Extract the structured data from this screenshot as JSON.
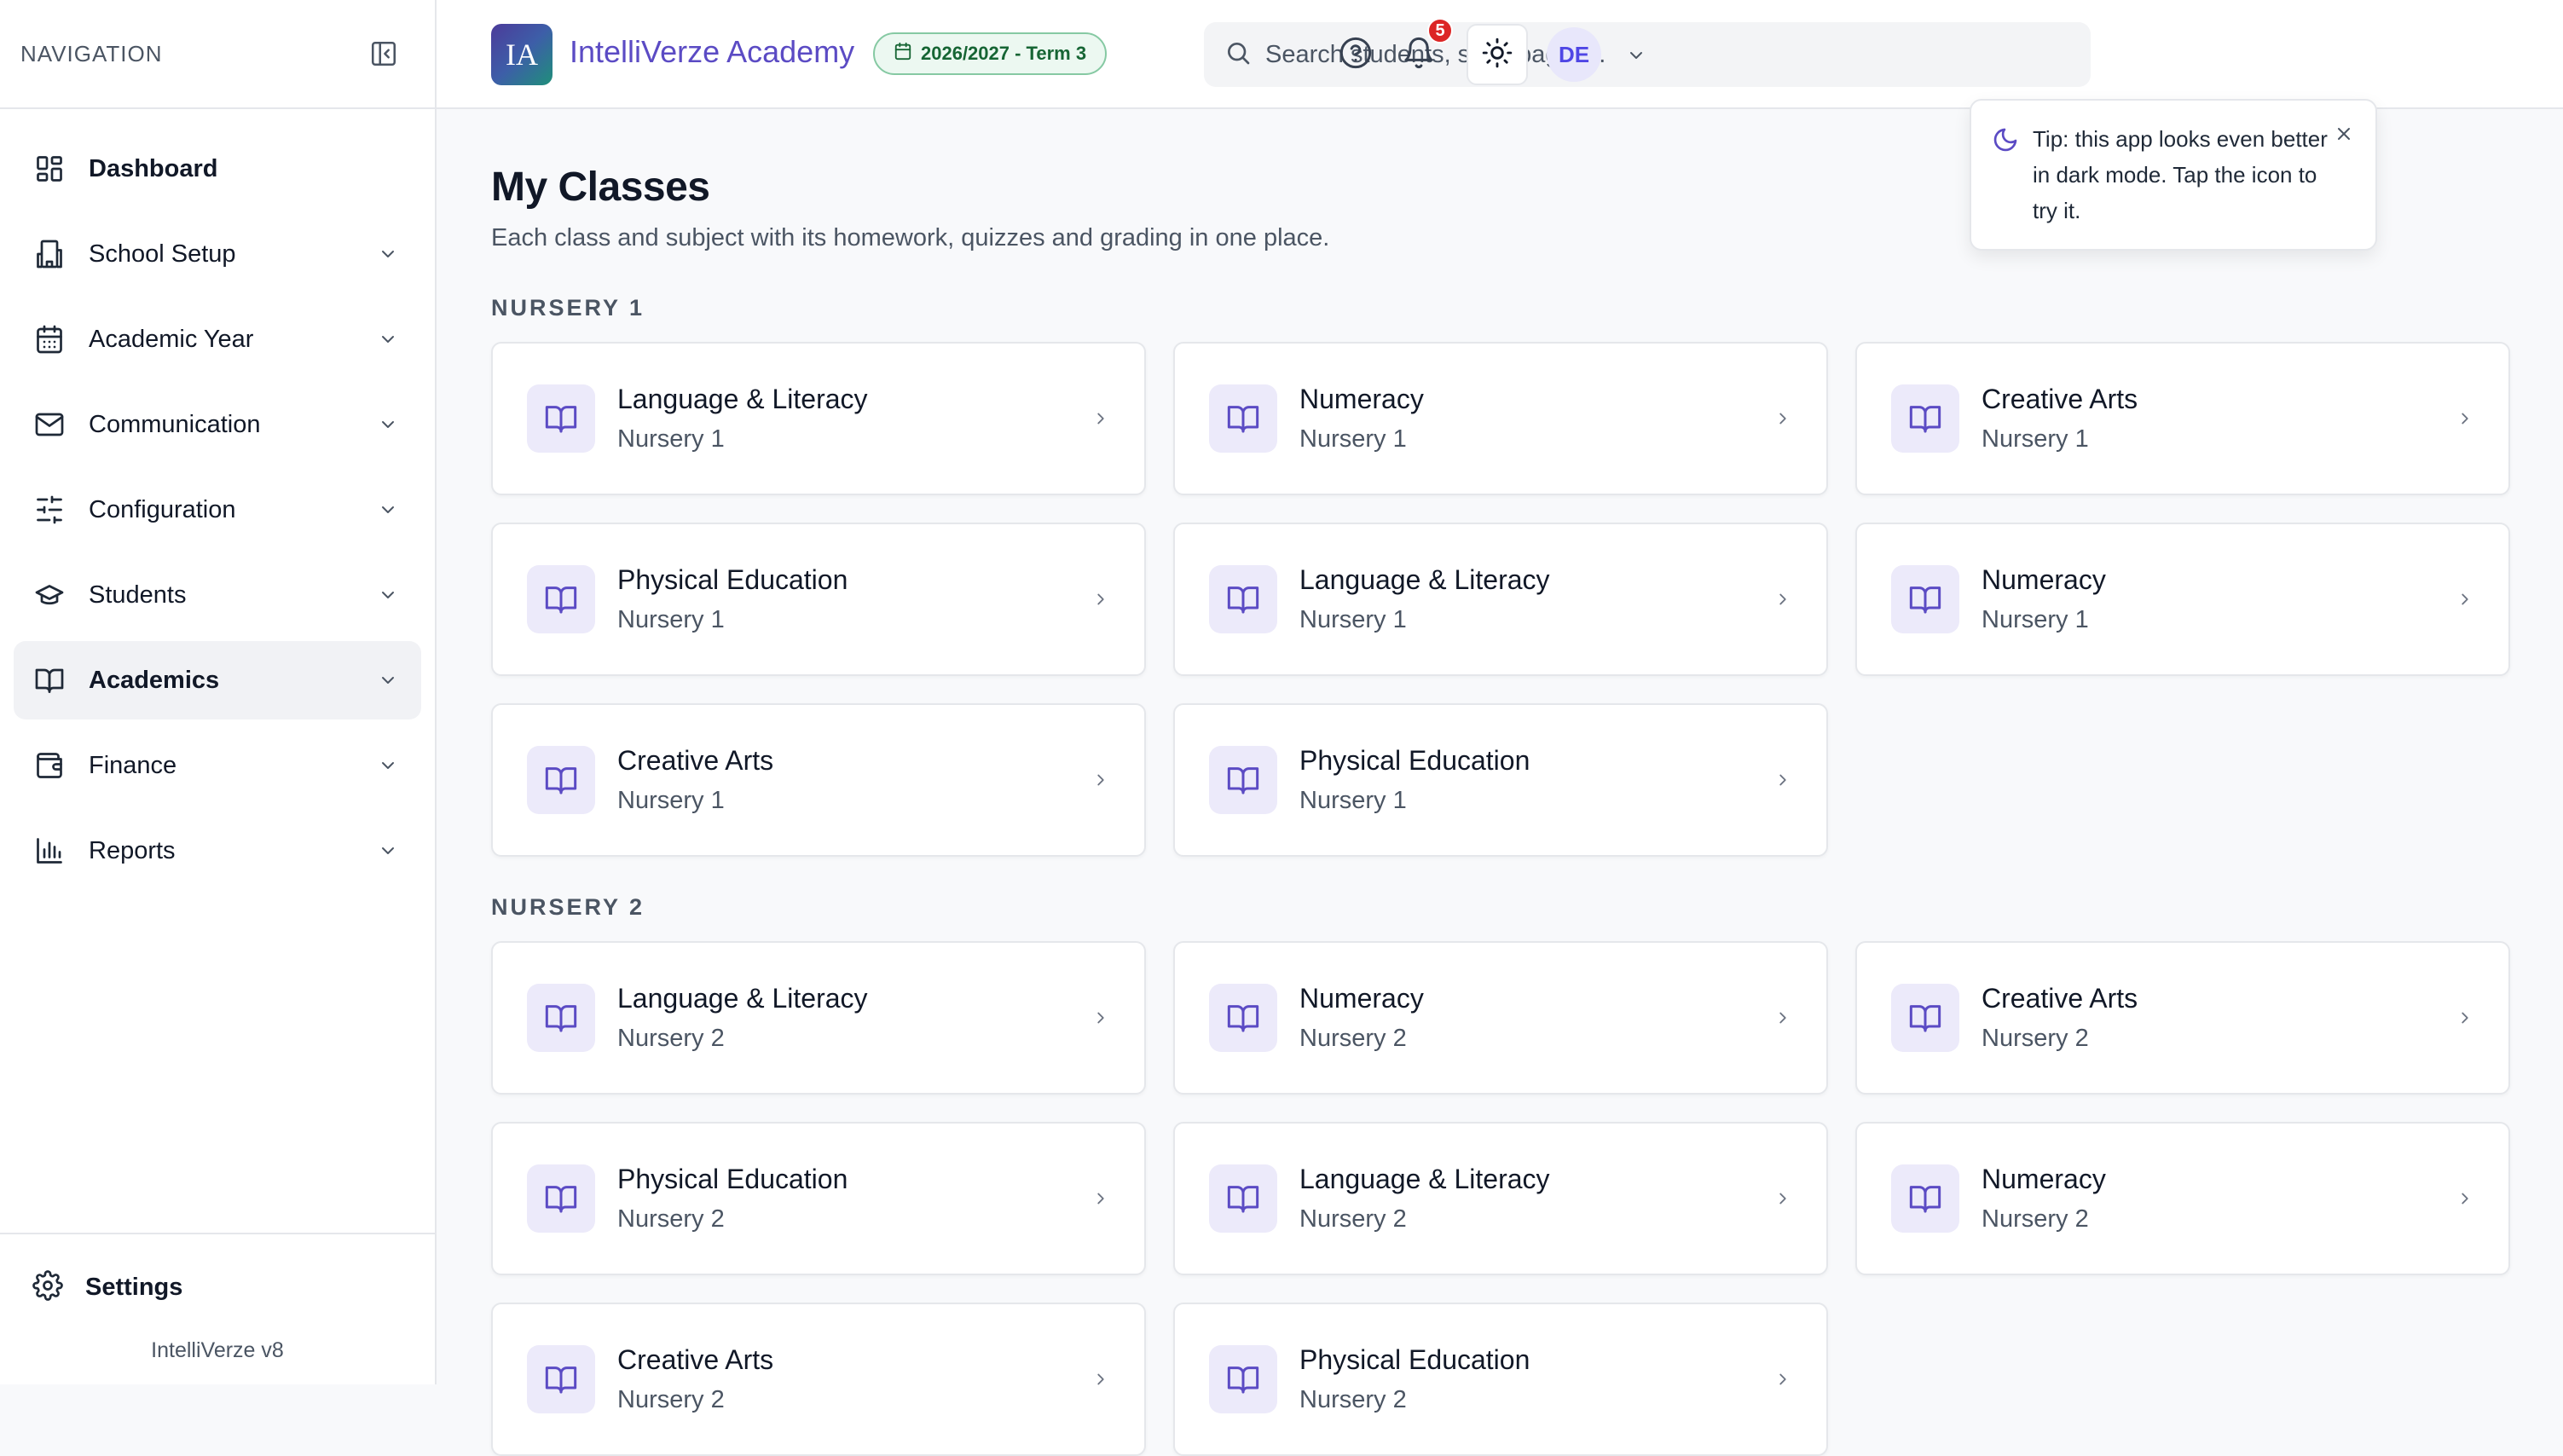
{
  "sidebar": {
    "title": "NAVIGATION",
    "items": [
      {
        "label": "Dashboard",
        "icon": "dashboard-icon"
      },
      {
        "label": "School Setup",
        "icon": "building-icon"
      },
      {
        "label": "Academic Year",
        "icon": "calendar-icon"
      },
      {
        "label": "Communication",
        "icon": "mail-icon"
      },
      {
        "label": "Configuration",
        "icon": "sliders-icon"
      },
      {
        "label": "Students",
        "icon": "graduation-cap-icon"
      },
      {
        "label": "Academics",
        "icon": "book-icon"
      },
      {
        "label": "Finance",
        "icon": "wallet-icon"
      },
      {
        "label": "Reports",
        "icon": "bar-chart-icon"
      }
    ],
    "settings_label": "Settings",
    "version": "IntelliVerze v8"
  },
  "header": {
    "logo_text": "IA",
    "app_name": "IntelliVerze Academy",
    "term": "2026/2027 - Term 3",
    "search_placeholder": "Search students, staff, pages...",
    "notification_count": "5",
    "avatar_initials": "DE"
  },
  "tip": {
    "text": "Tip: this app looks even better in dark mode. Tap the icon to try it."
  },
  "main": {
    "title": "My Classes",
    "subtitle": "Each class and subject with its homework, quizzes and grading in one place.",
    "sections": [
      {
        "title": "NURSERY 1",
        "cards": [
          {
            "title": "Language & Literacy",
            "sub": "Nursery 1"
          },
          {
            "title": "Numeracy",
            "sub": "Nursery 1"
          },
          {
            "title": "Creative Arts",
            "sub": "Nursery 1"
          },
          {
            "title": "Physical Education",
            "sub": "Nursery 1"
          },
          {
            "title": "Language & Literacy",
            "sub": "Nursery 1"
          },
          {
            "title": "Numeracy",
            "sub": "Nursery 1"
          },
          {
            "title": "Creative Arts",
            "sub": "Nursery 1"
          },
          {
            "title": "Physical Education",
            "sub": "Nursery 1"
          }
        ]
      },
      {
        "title": "NURSERY 2",
        "cards": [
          {
            "title": "Language & Literacy",
            "sub": "Nursery 2"
          },
          {
            "title": "Numeracy",
            "sub": "Nursery 2"
          },
          {
            "title": "Creative Arts",
            "sub": "Nursery 2"
          },
          {
            "title": "Physical Education",
            "sub": "Nursery 2"
          },
          {
            "title": "Language & Literacy",
            "sub": "Nursery 2"
          },
          {
            "title": "Numeracy",
            "sub": "Nursery 2"
          },
          {
            "title": "Creative Arts",
            "sub": "Nursery 2"
          },
          {
            "title": "Physical Education",
            "sub": "Nursery 2"
          }
        ]
      }
    ]
  },
  "colors": {
    "accent": "#5b4bc4",
    "term_badge_bg": "#ecf8f1",
    "term_badge_text": "#166534",
    "notification_badge": "#dc2626",
    "card_icon_bg": "#eceafa"
  }
}
